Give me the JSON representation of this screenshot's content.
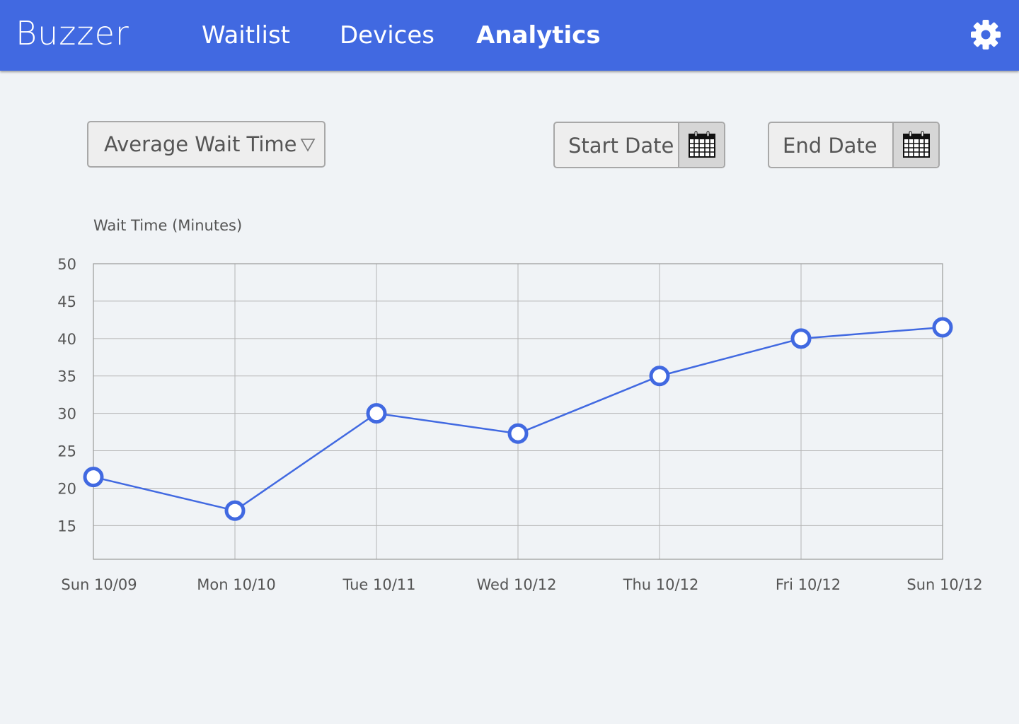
{
  "app": {
    "title": "Buzzer"
  },
  "nav": {
    "tabs": [
      {
        "label": "Waitlist",
        "active": false
      },
      {
        "label": "Devices",
        "active": false
      },
      {
        "label": "Analytics",
        "active": true
      }
    ],
    "settings_icon": "gear-icon"
  },
  "colors": {
    "header": "#4169e1",
    "line": "#4169e1",
    "background": "#f0f3f6"
  },
  "filters": {
    "metric": {
      "selected": "Average Wait Time",
      "icon": "triangle-down-icon"
    },
    "start_date": {
      "label": "Start Date",
      "icon": "calendar-icon"
    },
    "end_date": {
      "label": "End Date",
      "icon": "calendar-icon"
    }
  },
  "chart_data": {
    "type": "line",
    "title": "",
    "ylabel": "Wait Time (Minutes)",
    "xlabel": "",
    "categories": [
      "Sun 10/09",
      "Mon 10/10",
      "Tue 10/11",
      "Wed 10/12",
      "Thu 10/12",
      "Fri 10/12",
      "Sun 10/12"
    ],
    "values": [
      21.5,
      17,
      30,
      27.3,
      35,
      40,
      41.5
    ],
    "yticks": [
      15,
      20,
      25,
      30,
      35,
      40,
      45,
      50
    ],
    "ylim": [
      10.5,
      50
    ],
    "grid": true
  }
}
